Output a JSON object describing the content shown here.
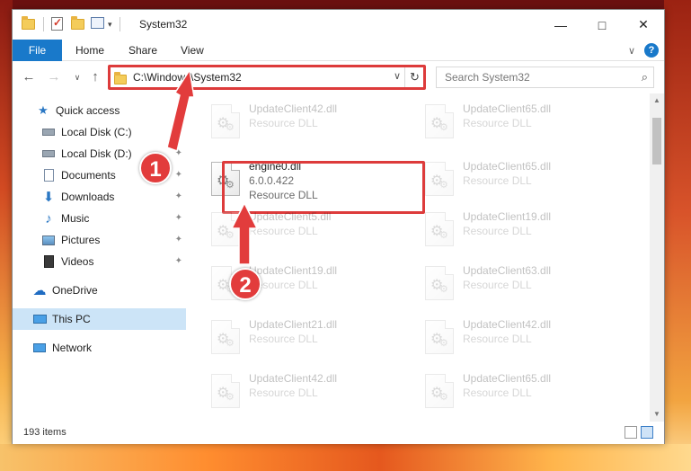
{
  "window": {
    "title": "System32"
  },
  "ribbon": {
    "tabs": [
      {
        "label": "File"
      },
      {
        "label": "Home"
      },
      {
        "label": "Share"
      },
      {
        "label": "View"
      }
    ]
  },
  "address_bar": {
    "path": "C:\\Windows\\System32"
  },
  "search": {
    "placeholder": "Search System32"
  },
  "sidebar": {
    "items": [
      {
        "label": "Quick access",
        "icon": "star-icon"
      },
      {
        "label": "Local Disk (C:)",
        "icon": "drive-icon"
      },
      {
        "label": "Local Disk (D:)",
        "icon": "drive-icon"
      },
      {
        "label": "Documents",
        "icon": "documents-icon"
      },
      {
        "label": "Downloads",
        "icon": "download-icon"
      },
      {
        "label": "Music",
        "icon": "music-icon"
      },
      {
        "label": "Pictures",
        "icon": "pictures-icon"
      },
      {
        "label": "Videos",
        "icon": "videos-icon"
      },
      {
        "label": "OneDrive",
        "icon": "cloud-icon"
      },
      {
        "label": "This PC",
        "icon": "computer-icon"
      },
      {
        "label": "Network",
        "icon": "network-icon"
      }
    ]
  },
  "files": [
    {
      "name": "UpdateClient42.dll",
      "type": "Resource DLL"
    },
    {
      "name": "UpdateClient65.dll",
      "type": "Resource DLL"
    },
    {
      "name": "engine0.dll",
      "version": "6.0.0.422",
      "type": "Resource DLL"
    },
    {
      "name": "UpdateClient65.dll",
      "type": "Resource DLL"
    },
    {
      "name": "UpdateClient5.dll",
      "type": "Resource DLL"
    },
    {
      "name": "UpdateClient19.dll",
      "type": "Resource DLL"
    },
    {
      "name": "UpdateClient19.dll",
      "type": "Resource DLL"
    },
    {
      "name": "UpdateClient63.dll",
      "type": "Resource DLL"
    },
    {
      "name": "UpdateClient21.dll",
      "type": "Resource DLL"
    },
    {
      "name": "UpdateClient42.dll",
      "type": "Resource DLL"
    },
    {
      "name": "UpdateClient42.dll",
      "type": "Resource DLL"
    },
    {
      "name": "UpdateClient65.dll",
      "type": "Resource DLL"
    }
  ],
  "status": {
    "item_count": "193 items"
  },
  "annotations": {
    "step1": "1",
    "step2": "2",
    "color": "#e23c3c"
  }
}
